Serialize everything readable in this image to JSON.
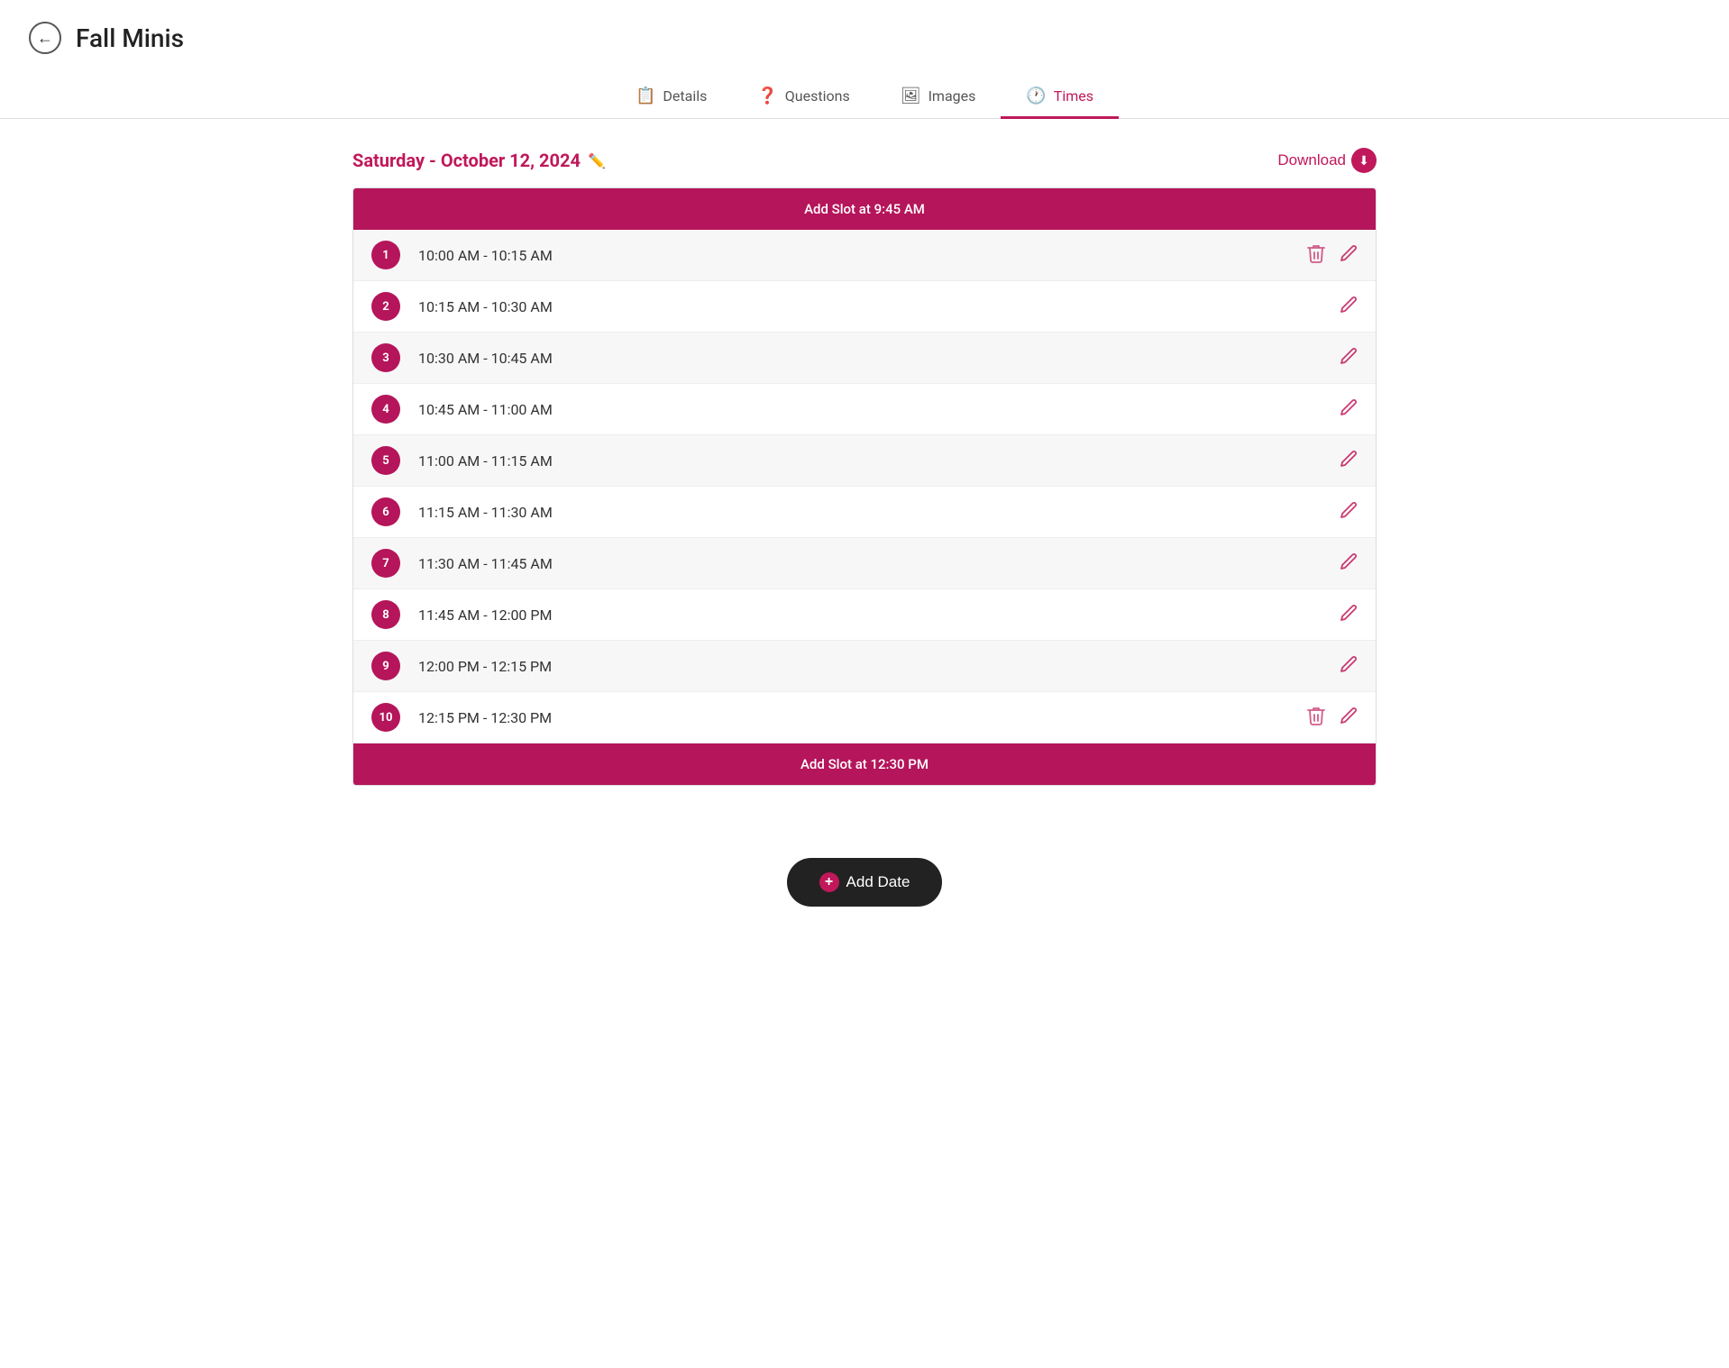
{
  "header": {
    "back_label": "←",
    "title": "Fall Minis"
  },
  "tabs": [
    {
      "id": "details",
      "label": "Details",
      "icon": "📋",
      "active": false
    },
    {
      "id": "questions",
      "label": "Questions",
      "icon": "❓",
      "active": false
    },
    {
      "id": "images",
      "label": "Images",
      "icon": "🖼",
      "active": false
    },
    {
      "id": "times",
      "label": "Times",
      "icon": "🕐",
      "active": true
    }
  ],
  "schedule": {
    "date_label": "Saturday - October 12, 2024",
    "download_label": "Download",
    "add_slot_top_label": "Add Slot at 9:45 AM",
    "add_slot_bottom_label": "Add Slot at 12:30 PM",
    "slots": [
      {
        "number": "1",
        "time": "10:00 AM - 10:15 AM",
        "has_delete": true
      },
      {
        "number": "2",
        "time": "10:15 AM - 10:30 AM",
        "has_delete": false
      },
      {
        "number": "3",
        "time": "10:30 AM - 10:45 AM",
        "has_delete": false
      },
      {
        "number": "4",
        "time": "10:45 AM - 11:00 AM",
        "has_delete": false
      },
      {
        "number": "5",
        "time": "11:00 AM - 11:15 AM",
        "has_delete": false
      },
      {
        "number": "6",
        "time": "11:15 AM - 11:30 AM",
        "has_delete": false
      },
      {
        "number": "7",
        "time": "11:30 AM - 11:45 AM",
        "has_delete": false
      },
      {
        "number": "8",
        "time": "11:45 AM - 12:00 PM",
        "has_delete": false
      },
      {
        "number": "9",
        "time": "12:00 PM - 12:15 PM",
        "has_delete": false
      },
      {
        "number": "10",
        "time": "12:15 PM - 12:30 PM",
        "has_delete": true
      }
    ]
  },
  "add_date_label": "Add Date",
  "colors": {
    "primary": "#b5155a",
    "text_primary": "#222",
    "text_muted": "#555"
  }
}
